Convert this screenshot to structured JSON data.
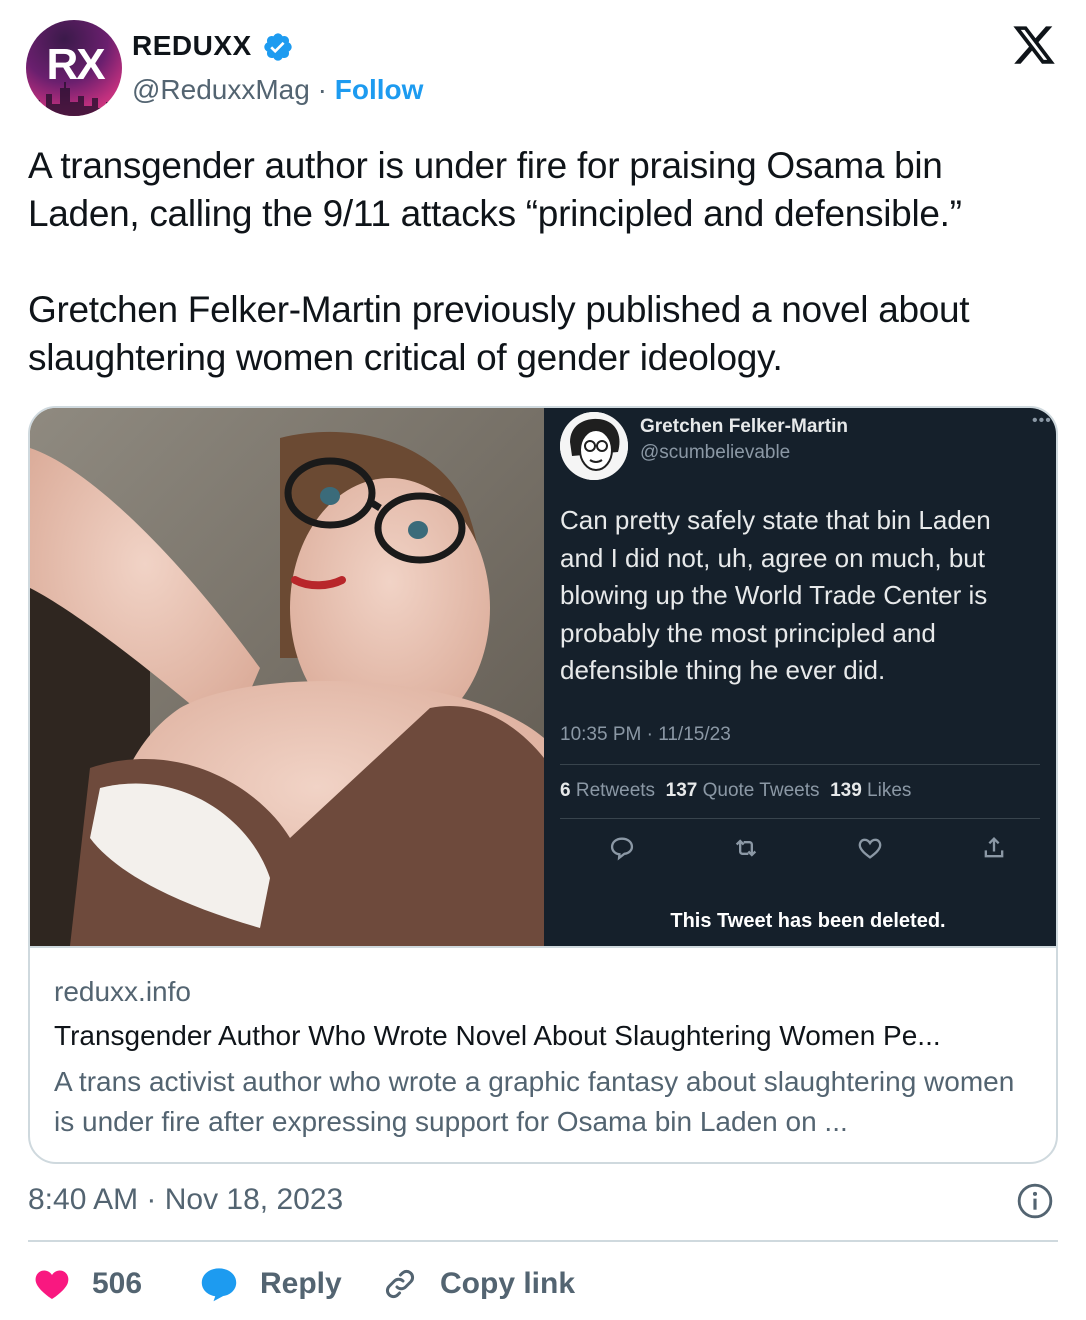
{
  "author": {
    "name": "REDUXX",
    "handle": "@ReduxxMag",
    "separator": " · ",
    "follow_label": "Follow",
    "avatar_text": "RX"
  },
  "tweet": {
    "paragraphs": [
      "A transgender author is under fire for praising Osama bin Laden, calling the 9/11 attacks “principled and defensible.”",
      "Gretchen Felker-Martin previously published a novel about slaughtering women critical of gender ideology."
    ],
    "timestamp": "8:40 AM · Nov 18, 2023"
  },
  "card": {
    "domain": "reduxx.info",
    "title": "Transgender Author Who Wrote Novel About Slaughtering Women Pe...",
    "description": "A trans activist author who wrote a graphic fantasy about slaughtering women is under fire after expressing support for Osama bin Laden on ...",
    "embedded_tweet": {
      "name": "Gretchen Felker-Martin",
      "handle": "@scumbelievable",
      "text": "Can pretty safely state that bin Laden and I did not, uh, agree on much, but blowing up the World Trade Center is probably the most principled and defensible thing he ever did.",
      "time": "10:35 PM · 11/15/23",
      "retweets_count": "6",
      "retweets_label": "Retweets",
      "quotes_count": "137",
      "quotes_label": "Quote Tweets",
      "likes_count": "139",
      "likes_label": "Likes",
      "deleted_notice": "This Tweet has been deleted."
    }
  },
  "actions": {
    "likes": "506",
    "reply_label": "Reply",
    "copy_link_label": "Copy link"
  },
  "colors": {
    "accent": "#1d9bf0",
    "like": "#f91880",
    "text": "#0f1419",
    "secondary": "#536471",
    "border": "#cfd9de",
    "dark_bg": "#15202b"
  }
}
